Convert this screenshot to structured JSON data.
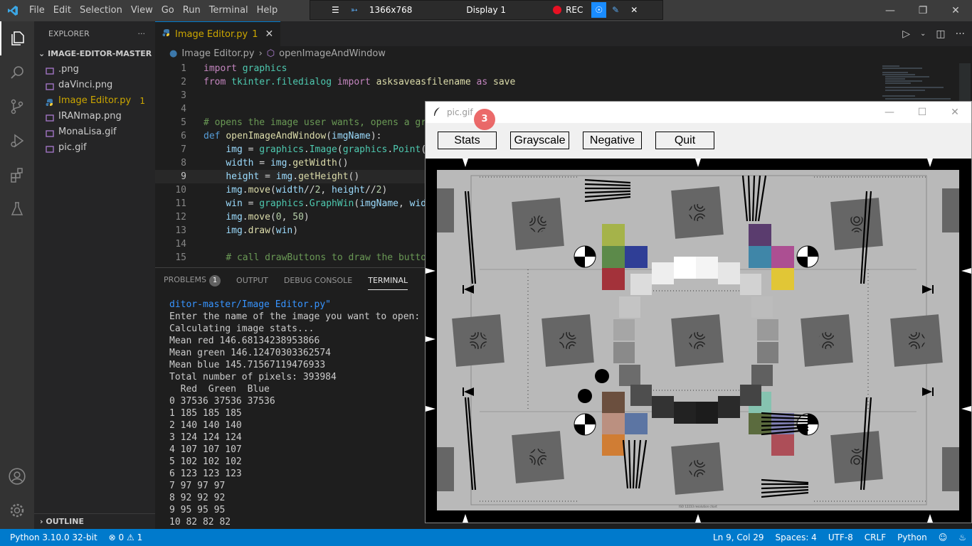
{
  "titlebar": {
    "menu": [
      "File",
      "Edit",
      "Selection",
      "View",
      "Go",
      "Run",
      "Terminal",
      "Help"
    ]
  },
  "remote": {
    "resolution": "1366x768",
    "display": "Display 1",
    "rec": "REC"
  },
  "sidebar": {
    "title": "EXPLORER",
    "more": "···",
    "folder": "IMAGE-EDITOR-MASTER",
    "files": [
      {
        "name": ".png",
        "icon": "image-file-icon"
      },
      {
        "name": "daVinci.png",
        "icon": "image-file-icon"
      },
      {
        "name": "Image Editor.py",
        "icon": "python-file-icon",
        "badge": "1"
      },
      {
        "name": "IRANmap.png",
        "icon": "image-file-icon"
      },
      {
        "name": "MonaLisa.gif",
        "icon": "image-file-icon"
      },
      {
        "name": "pic.gif",
        "icon": "image-file-icon"
      }
    ],
    "outline": "OUTLINE"
  },
  "editor": {
    "tab": {
      "label": "Image Editor.py",
      "badge": "1"
    },
    "breadcrumb": {
      "file": "Image Editor.py",
      "symbol": "openImageAndWindow"
    },
    "line_numbers": [
      "1",
      "2",
      "3",
      "4",
      "5",
      "6",
      "7",
      "8",
      "9",
      "10",
      "11",
      "12",
      "13",
      "14",
      "15"
    ]
  },
  "panel": {
    "tabs": [
      "PROBLEMS",
      "OUTPUT",
      "DEBUG CONSOLE",
      "TERMINAL"
    ],
    "problems_count": "1",
    "terminal_path": "ditor-master/Image Editor.py\"",
    "terminal_lines": [
      "Enter the name of the image you want to open: pic.g",
      "Calculating image stats...",
      "Mean red 146.68134238953866",
      "Mean green 146.12470303362574",
      "Mean blue 145.71567119476933",
      "Total number of pixels: 393984",
      "  Red  Green  Blue",
      "0 37536 37536 37536",
      "1 185 185 185",
      "2 140 140 140",
      "3 124 124 124",
      "4 107 107 107",
      "5 102 102 102",
      "6 123 123 123",
      "7 97 97 97",
      "8 92 92 92",
      "9 95 95 95",
      "10 82 82 82"
    ]
  },
  "statusbar": {
    "python": "Python 3.10.0 32-bit",
    "errors": "0",
    "warnings": "1",
    "position": "Ln 9, Col 29",
    "spaces": "Spaces: 4",
    "encoding": "UTF-8",
    "eol": "CRLF",
    "language": "Python"
  },
  "tkwindow": {
    "title": "pic.gif",
    "notification": "3",
    "buttons": [
      "Stats",
      "Grayscale",
      "Negative",
      "Quit"
    ],
    "caption": "ISO 12233 resolution chart"
  },
  "colors": {
    "accent": "#007acc",
    "warning": "#cca700",
    "record": "#e81123"
  }
}
